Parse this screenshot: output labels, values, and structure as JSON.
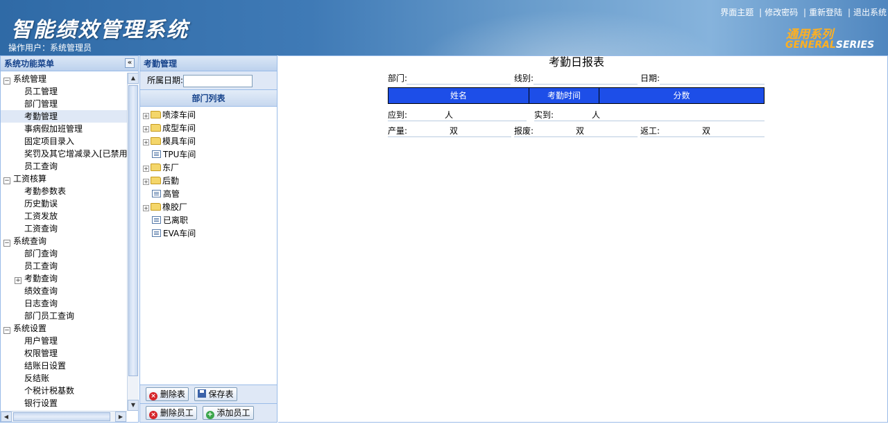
{
  "header": {
    "app_title": "智能绩效管理系统",
    "operator": "操作用户：系统管理员",
    "links": [
      "界面主题",
      "修改密码",
      "重新登陆",
      "退出系统"
    ],
    "link_sep": "|",
    "brand_cn": "通用系列",
    "brand_en_a": "GENERAL",
    "brand_en_b": "SERIES"
  },
  "left_panel": {
    "title": "系统功能菜单",
    "collapse_icon": "«",
    "menu": [
      {
        "type": "group",
        "label": "系统管理",
        "toggle": "−"
      },
      {
        "type": "item",
        "label": "员工管理"
      },
      {
        "type": "item",
        "label": "部门管理"
      },
      {
        "type": "item",
        "label": "考勤管理",
        "selected": true
      },
      {
        "type": "item",
        "label": "事病假加班管理"
      },
      {
        "type": "item",
        "label": "固定项目录入"
      },
      {
        "type": "item",
        "label": "奖罚及其它增减录入[已禁用"
      },
      {
        "type": "item",
        "label": "员工查询"
      },
      {
        "type": "group",
        "label": "工资核算",
        "toggle": "−"
      },
      {
        "type": "item",
        "label": "考勤参数表"
      },
      {
        "type": "item",
        "label": "历史勤误"
      },
      {
        "type": "item",
        "label": "工资发放"
      },
      {
        "type": "item",
        "label": "工资查询"
      },
      {
        "type": "group",
        "label": "系统查询",
        "toggle": "−"
      },
      {
        "type": "item",
        "label": "部门查询"
      },
      {
        "type": "item",
        "label": "员工查询"
      },
      {
        "type": "subgroup",
        "label": "考勤查询",
        "toggle": "+"
      },
      {
        "type": "item",
        "label": "绩效查询"
      },
      {
        "type": "item",
        "label": "日志查询"
      },
      {
        "type": "item",
        "label": "部门员工查询"
      },
      {
        "type": "group",
        "label": "系统设置",
        "toggle": "−"
      },
      {
        "type": "item",
        "label": "用户管理"
      },
      {
        "type": "item",
        "label": "权限管理"
      },
      {
        "type": "item",
        "label": "结账日设置"
      },
      {
        "type": "item",
        "label": "反结账"
      },
      {
        "type": "item",
        "label": "个税计税基数"
      },
      {
        "type": "item",
        "label": "银行设置"
      }
    ]
  },
  "middle_panel": {
    "title": "考勤管理",
    "date_label": "所属日期:",
    "date_value": "",
    "dept_list_title": "部门列表",
    "tree": [
      {
        "label": "喷漆车间",
        "kind": "folder",
        "expandable": true
      },
      {
        "label": "成型车间",
        "kind": "folder",
        "expandable": true
      },
      {
        "label": "模具车间",
        "kind": "folder",
        "expandable": true
      },
      {
        "label": "TPU车间",
        "kind": "doc",
        "expandable": false
      },
      {
        "label": "东厂",
        "kind": "folder",
        "expandable": true
      },
      {
        "label": "后勤",
        "kind": "folder",
        "expandable": true
      },
      {
        "label": "高管",
        "kind": "doc",
        "expandable": false
      },
      {
        "label": "橡胶厂",
        "kind": "folder",
        "expandable": true
      },
      {
        "label": "已离职",
        "kind": "doc",
        "expandable": false
      },
      {
        "label": "EVA车间",
        "kind": "doc",
        "expandable": false
      }
    ],
    "buttons": {
      "delete_table": "删除表",
      "save_table": "保存表",
      "delete_employee": "删除员工",
      "add_employee": "添加员工"
    }
  },
  "report": {
    "title": "考勤日报表",
    "dept_label": "部门:",
    "line_label": "线别:",
    "date_label": "日期:",
    "columns": [
      "姓名",
      "考勤时间",
      "分数"
    ],
    "expected_label": "应到:",
    "expected_unit": "人",
    "actual_label": "实到:",
    "actual_unit": "人",
    "output_label": "产量:",
    "output_unit": "双",
    "scrap_label": "报废:",
    "scrap_unit": "双",
    "rework_label": "返工:",
    "rework_unit": "双"
  }
}
